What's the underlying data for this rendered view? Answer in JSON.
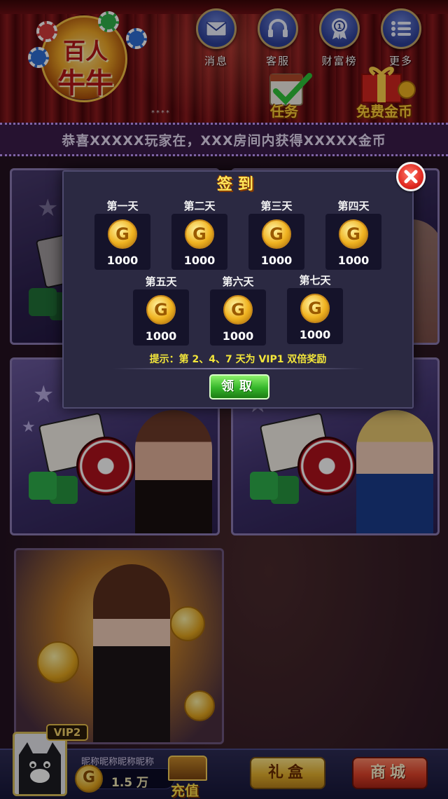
{
  "header": {
    "logo_line1": "百人",
    "logo_line2": "牛牛",
    "nav": [
      {
        "label": "消息",
        "icon": "mail-icon"
      },
      {
        "label": "客服",
        "icon": "headset-icon"
      },
      {
        "label": "财富榜",
        "icon": "rank-badge-icon"
      },
      {
        "label": "更多",
        "icon": "menu-list-icon"
      }
    ],
    "task_label": "任务",
    "free_gold_label": "免费金币",
    "page_dots": "****"
  },
  "marquee": {
    "text": "恭喜XXXXX玩家在，XXX房间内获得XXXXX金币"
  },
  "signin": {
    "title": "签到",
    "days": [
      {
        "label": "第一天",
        "amount": "1000"
      },
      {
        "label": "第二天",
        "amount": "1000"
      },
      {
        "label": "第三天",
        "amount": "1000"
      },
      {
        "label": "第四天",
        "amount": "1000"
      },
      {
        "label": "第五天",
        "amount": "1000"
      },
      {
        "label": "第六天",
        "amount": "1000"
      },
      {
        "label": "第七天",
        "amount": "1000"
      }
    ],
    "coin_letter": "G",
    "tip": "提示：第 2、4、7 天为 VIP1 双倍奖励",
    "claim_label": "领取"
  },
  "player": {
    "vip": "VIP2",
    "nickname": "昵称昵称昵称昵称",
    "coin_letter": "G",
    "coins": "1.5 万",
    "recharge_label": "充值"
  },
  "bottom_buttons": {
    "gift_label": "礼盒",
    "shop_label": "商城"
  },
  "colors": {
    "accent_yellow": "#ffe65a",
    "claim_green": "#35b62a",
    "close_red": "#e12a22",
    "modal_bg": "#2b2942"
  }
}
